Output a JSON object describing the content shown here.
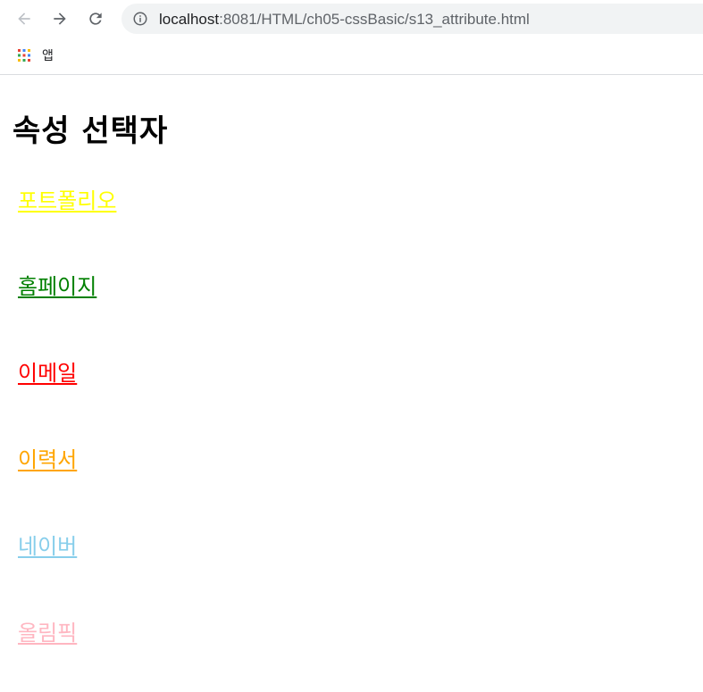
{
  "browser": {
    "url_host": "localhost",
    "url_path": ":8081/HTML/ch05-cssBasic/s13_attribute.html",
    "bookmarks": [
      {
        "label": "앱",
        "icon": "apps-grid-icon"
      }
    ]
  },
  "page": {
    "title": "속성 선택자",
    "links": [
      {
        "label": "포트폴리오",
        "color": "#ffff00"
      },
      {
        "label": "홈페이지",
        "color": "#008000"
      },
      {
        "label": "이메일",
        "color": "#ff0000"
      },
      {
        "label": "이력서",
        "color": "#ffa500"
      },
      {
        "label": "네이버",
        "color": "#87ceeb"
      },
      {
        "label": "올림픽",
        "color": "#ffb6c1"
      }
    ]
  },
  "colors": {
    "toolbar_icon": "#5f6368",
    "omnibox_bg": "#f1f3f4"
  }
}
